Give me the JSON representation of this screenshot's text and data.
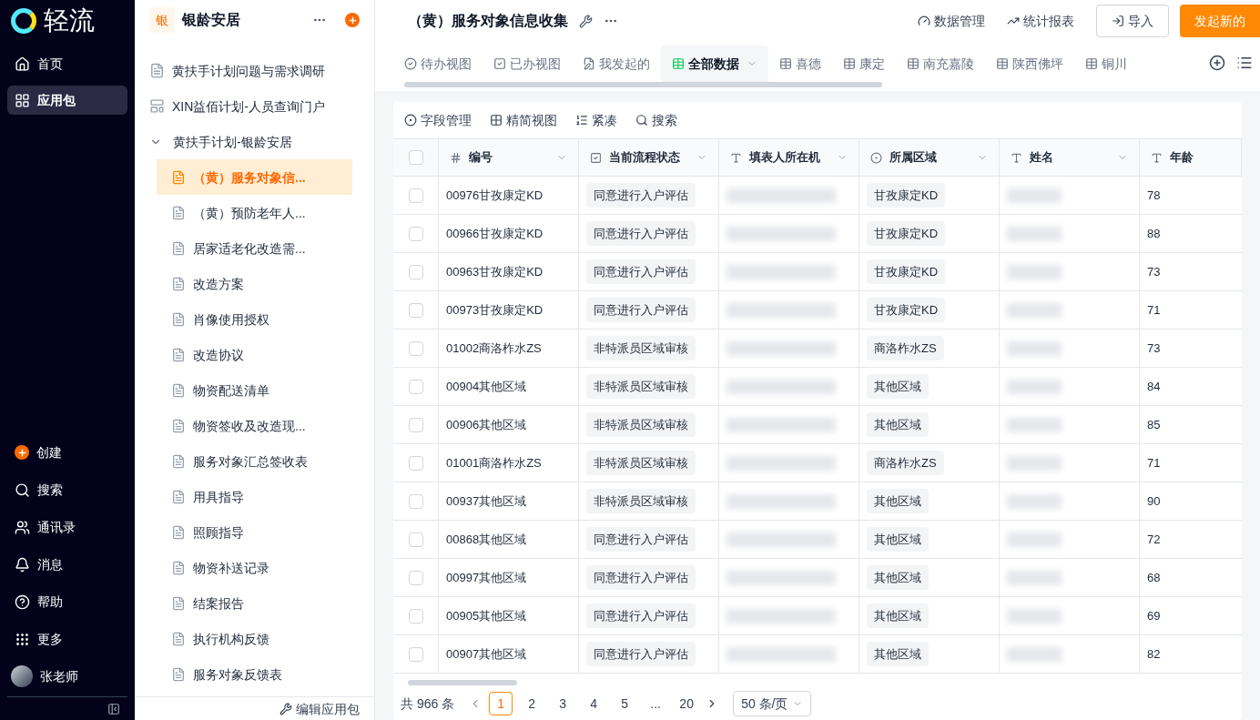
{
  "nav": {
    "logo": "轻流",
    "top": [
      {
        "label": "首页",
        "selected": false
      },
      {
        "label": "应用包",
        "selected": true
      }
    ],
    "bottom": [
      {
        "label": "创建",
        "kind": "create"
      },
      {
        "label": "搜索",
        "kind": "link"
      },
      {
        "label": "通讯录",
        "kind": "link"
      },
      {
        "label": "消息",
        "kind": "link"
      },
      {
        "label": "帮助",
        "kind": "link"
      },
      {
        "label": "更多",
        "kind": "link"
      },
      {
        "label": "张老师",
        "kind": "user"
      }
    ]
  },
  "app": {
    "badge": "银",
    "title": "银龄安居",
    "footer": "编辑应用包",
    "items": [
      {
        "label": "黄扶手计划问题与需求调研",
        "kind": "form",
        "selected": false
      },
      {
        "label": "XIN益佰计划-人员查询门户",
        "kind": "portal",
        "selected": false
      },
      {
        "label": "黄扶手计划-银龄安居",
        "kind": "group",
        "expanded": true,
        "children": [
          {
            "label": "（黄）服务对象信...",
            "selected": true
          },
          {
            "label": "（黄）预防老年人...",
            "selected": false
          },
          {
            "label": "居家适老化改造需...",
            "selected": false
          },
          {
            "label": "改造方案",
            "selected": false
          },
          {
            "label": "肖像使用授权",
            "selected": false
          },
          {
            "label": "改造协议",
            "selected": false
          },
          {
            "label": "物资配送清单",
            "selected": false
          },
          {
            "label": "物资签收及改造现...",
            "selected": false
          },
          {
            "label": "服务对象汇总签收表",
            "selected": false
          },
          {
            "label": "用具指导",
            "selected": false
          },
          {
            "label": "照顾指导",
            "selected": false
          },
          {
            "label": "物资补送记录",
            "selected": false
          },
          {
            "label": "结案报告",
            "selected": false
          },
          {
            "label": "执行机构反馈",
            "selected": false
          },
          {
            "label": "服务对象反馈表",
            "selected": false
          }
        ]
      }
    ]
  },
  "header": {
    "title": "（黄）服务对象信息收集",
    "links": [
      "数据管理",
      "统计报表"
    ],
    "import": "导入",
    "primary": "发起新的"
  },
  "views": [
    {
      "label": "待办视图",
      "selected": false
    },
    {
      "label": "已办视图",
      "selected": false
    },
    {
      "label": "我发起的",
      "selected": false
    },
    {
      "label": "全部数据",
      "selected": true
    },
    {
      "label": "喜德",
      "selected": false
    },
    {
      "label": "康定",
      "selected": false
    },
    {
      "label": "南充嘉陵",
      "selected": false
    },
    {
      "label": "陕西佛坪",
      "selected": false
    },
    {
      "label": "铜川",
      "selected": false
    }
  ],
  "toolbar": [
    "字段管理",
    "精简视图",
    "紧凑",
    "搜索"
  ],
  "table": {
    "all_checked": false,
    "columns": [
      "编号",
      "当前流程状态",
      "填表人所在机",
      "所属区域",
      "姓名",
      "年龄"
    ],
    "rows": [
      {
        "id": "00976甘孜康定KD",
        "status": "同意进行入户评估",
        "region": "甘孜康定KD",
        "age": "78",
        "checked": false
      },
      {
        "id": "00966甘孜康定KD",
        "status": "同意进行入户评估",
        "region": "甘孜康定KD",
        "age": "88",
        "checked": false
      },
      {
        "id": "00963甘孜康定KD",
        "status": "同意进行入户评估",
        "region": "甘孜康定KD",
        "age": "73",
        "checked": false
      },
      {
        "id": "00973甘孜康定KD",
        "status": "同意进行入户评估",
        "region": "甘孜康定KD",
        "age": "71",
        "checked": false
      },
      {
        "id": "01002商洛柞水ZS",
        "status": "非特派员区域审核",
        "region": "商洛柞水ZS",
        "age": "73",
        "checked": false
      },
      {
        "id": "00904其他区域",
        "status": "非特派员区域审核",
        "region": "其他区域",
        "age": "84",
        "checked": false
      },
      {
        "id": "00906其他区域",
        "status": "非特派员区域审核",
        "region": "其他区域",
        "age": "85",
        "checked": false
      },
      {
        "id": "01001商洛柞水ZS",
        "status": "非特派员区域审核",
        "region": "商洛柞水ZS",
        "age": "71",
        "checked": false
      },
      {
        "id": "00937其他区域",
        "status": "非特派员区域审核",
        "region": "其他区域",
        "age": "90",
        "checked": false
      },
      {
        "id": "00868其他区域",
        "status": "同意进行入户评估",
        "region": "其他区域",
        "age": "72",
        "checked": false
      },
      {
        "id": "00997其他区域",
        "status": "同意进行入户评估",
        "region": "其他区域",
        "age": "68",
        "checked": false
      },
      {
        "id": "00905其他区域",
        "status": "同意进行入户评估",
        "region": "其他区域",
        "age": "69",
        "checked": false
      },
      {
        "id": "00907其他区域",
        "status": "同意进行入户评估",
        "region": "其他区域",
        "age": "82",
        "checked": false
      }
    ]
  },
  "pagination": {
    "total": "共 966 条",
    "pages": [
      {
        "label": "1",
        "selected": true
      },
      {
        "label": "2",
        "selected": false
      },
      {
        "label": "3",
        "selected": false
      },
      {
        "label": "4",
        "selected": false
      },
      {
        "label": "5",
        "selected": false
      },
      {
        "label": "...",
        "selected": false
      },
      {
        "label": "20",
        "selected": false
      }
    ],
    "page_size": "50 条/页"
  }
}
